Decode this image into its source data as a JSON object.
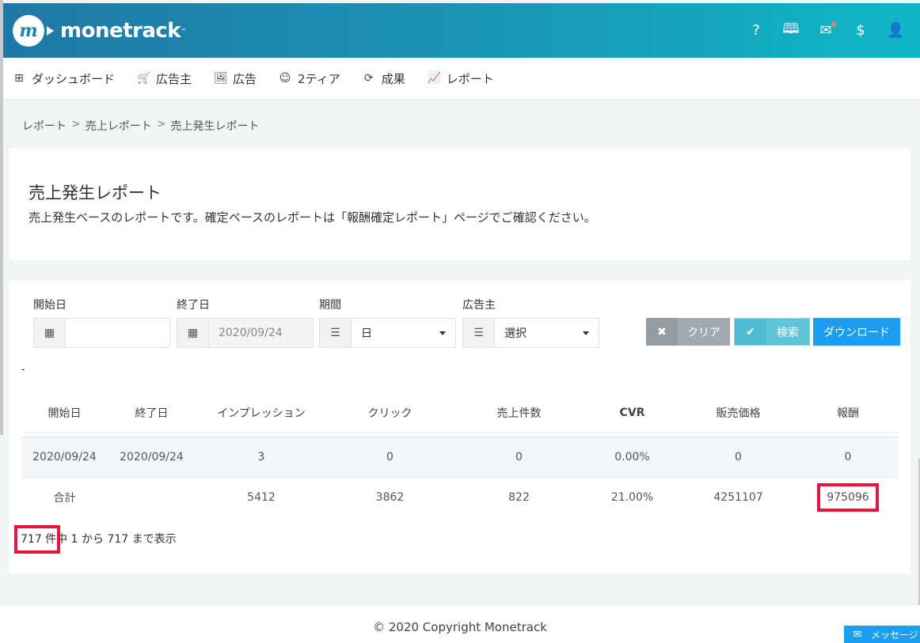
{
  "app": {
    "logo_mark": "m",
    "name": "monetrack",
    "tm": "™"
  },
  "header_icons": [
    {
      "name": "help-icon",
      "glyph": "?"
    },
    {
      "name": "book-icon",
      "glyph": "🕮"
    },
    {
      "name": "mail-icon",
      "glyph": "✉"
    },
    {
      "name": "dollar-icon",
      "glyph": "$"
    },
    {
      "name": "user-icon",
      "glyph": "👤"
    }
  ],
  "nav": {
    "items": [
      {
        "label": "ダッシュボード",
        "icon": "grid-icon",
        "glyph": "⊞"
      },
      {
        "label": "広告主",
        "icon": "cart-icon",
        "glyph": "🛒"
      },
      {
        "label": "広告",
        "icon": "image-icon",
        "glyph": "🖼"
      },
      {
        "label": "2ティア",
        "icon": "smile-icon",
        "glyph": "☺"
      },
      {
        "label": "成果",
        "icon": "refresh-icon",
        "glyph": "⟳"
      },
      {
        "label": "レポート",
        "icon": "chart-line-icon",
        "glyph": "📈"
      }
    ]
  },
  "breadcrumb": {
    "items": [
      "レポート",
      "売上レポート",
      "売上発生レポート"
    ],
    "separator": ">"
  },
  "page": {
    "title": "売上発生レポート",
    "description": "売上発生ベースのレポートです。確定ベースのレポートは「報酬確定レポート」ページでご確認ください。"
  },
  "filters": {
    "start_date": {
      "label": "開始日",
      "value": ""
    },
    "end_date": {
      "label": "終了日",
      "value": "2020/09/24"
    },
    "period": {
      "label": "期間",
      "value": "日"
    },
    "advertiser": {
      "label": "広告主",
      "value": "選択"
    }
  },
  "buttons": {
    "clear": "クリア",
    "search": "検索",
    "download": "ダウンロード"
  },
  "dash_text": "-",
  "table": {
    "headers": [
      "開始日",
      "終了日",
      "インプレッション",
      "クリック",
      "売上件数",
      "CVR",
      "販売価格",
      "報酬"
    ],
    "row": [
      "2020/09/24",
      "2020/09/24",
      "3",
      "0",
      "0",
      "0.00%",
      "0",
      "0"
    ],
    "total": {
      "label": "合計",
      "impressions": "5412",
      "clicks": "3862",
      "sales_count": "822",
      "cvr": "21.00%",
      "price": "4251107",
      "reward": "975096"
    }
  },
  "info_text": "717 件中 1 から 717 まで表示",
  "footer": {
    "copyright": "© 2020 Copyright Monetrack",
    "message_tab": "メッセージ"
  },
  "colors": {
    "header_start": "#1f78a8",
    "header_end": "#0fb7c6",
    "accent": "#1a9ff0",
    "highlight": "#e6143c"
  }
}
